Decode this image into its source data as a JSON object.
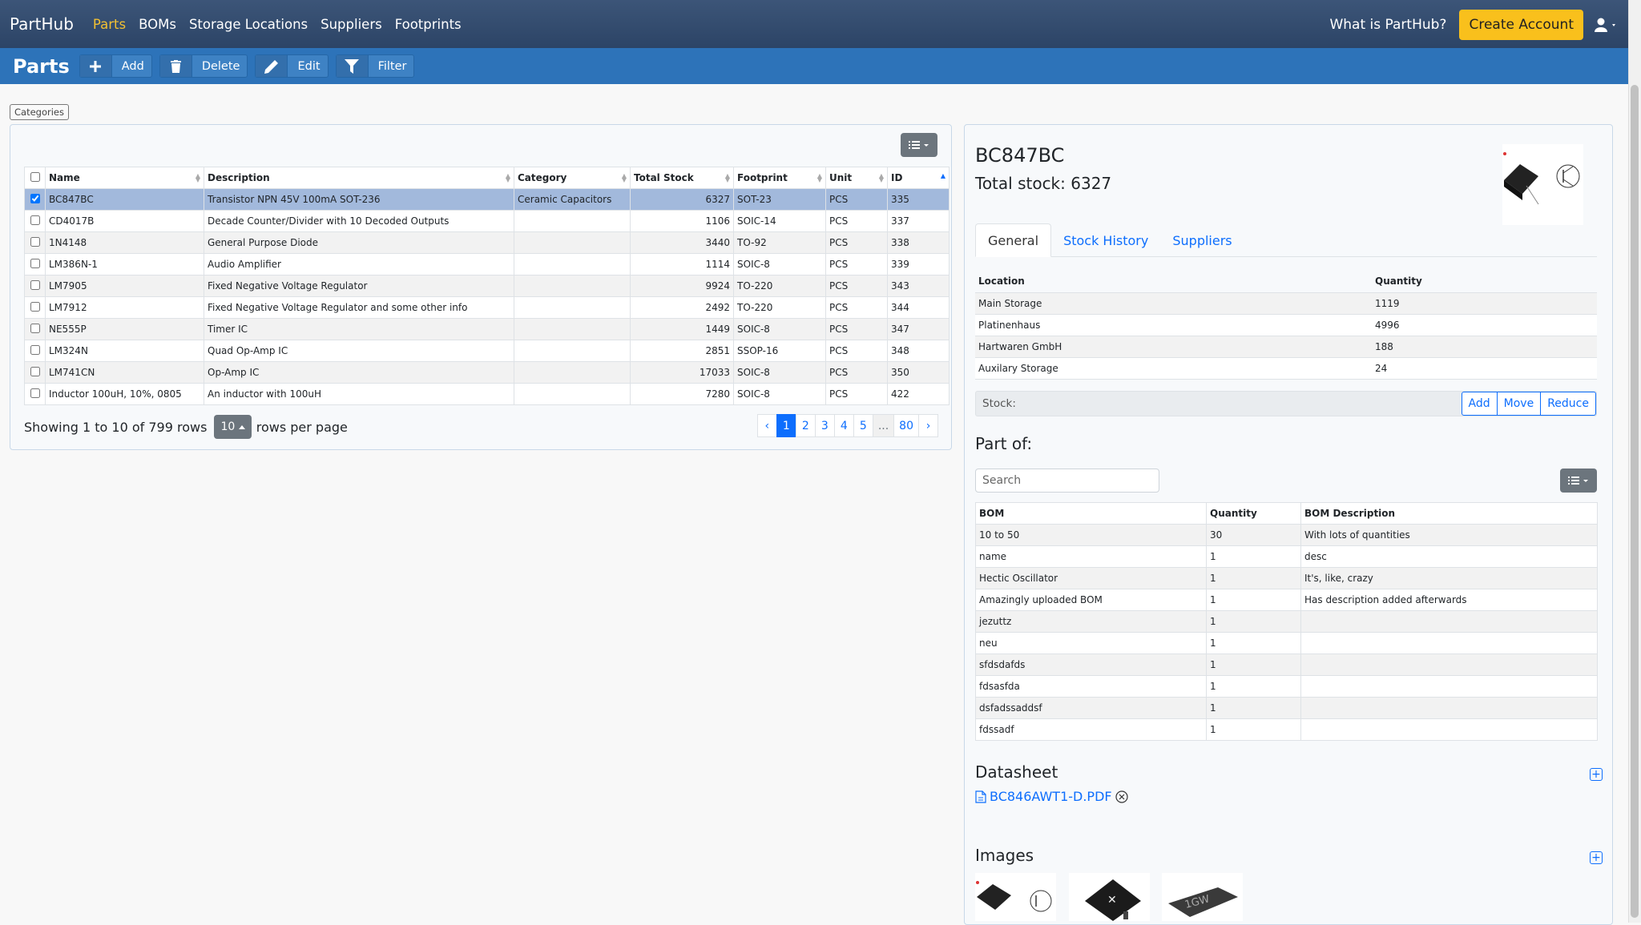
{
  "nav": {
    "brand": "PartHub",
    "links": [
      "Parts",
      "BOMs",
      "Storage Locations",
      "Suppliers",
      "Footprints"
    ],
    "what_is": "What is PartHub?",
    "create_account": "Create Account"
  },
  "toolbar": {
    "title": "Parts",
    "add": "Add",
    "delete": "Delete",
    "edit": "Edit",
    "filter": "Filter"
  },
  "categories_label": "Categories",
  "parts_table": {
    "headers": [
      "Name",
      "Description",
      "Category",
      "Total Stock",
      "Footprint",
      "Unit",
      "ID"
    ],
    "rows": [
      {
        "name": "BC847BC",
        "description": "Transistor NPN 45V 100mA SOT-236",
        "category": "Ceramic Capacitors",
        "stock": "6327",
        "footprint": "SOT-23",
        "unit": "PCS",
        "id": "335",
        "checked": true
      },
      {
        "name": "CD4017B",
        "description": "Decade Counter/Divider with 10 Decoded Outputs",
        "category": "",
        "stock": "1106",
        "footprint": "SOIC-14",
        "unit": "PCS",
        "id": "337",
        "checked": false
      },
      {
        "name": "1N4148",
        "description": "General Purpose Diode",
        "category": "",
        "stock": "3440",
        "footprint": "TO-92",
        "unit": "PCS",
        "id": "338",
        "checked": false
      },
      {
        "name": "LM386N-1",
        "description": "Audio Amplifier",
        "category": "",
        "stock": "1114",
        "footprint": "SOIC-8",
        "unit": "PCS",
        "id": "339",
        "checked": false
      },
      {
        "name": "LM7905",
        "description": "Fixed Negative Voltage Regulator",
        "category": "",
        "stock": "9924",
        "footprint": "TO-220",
        "unit": "PCS",
        "id": "343",
        "checked": false
      },
      {
        "name": "LM7912",
        "description": "Fixed Negative Voltage Regulator and some other info",
        "category": "",
        "stock": "2492",
        "footprint": "TO-220",
        "unit": "PCS",
        "id": "344",
        "checked": false
      },
      {
        "name": "NE555P",
        "description": "Timer IC",
        "category": "",
        "stock": "1449",
        "footprint": "SOIC-8",
        "unit": "PCS",
        "id": "347",
        "checked": false
      },
      {
        "name": "LM324N",
        "description": "Quad Op-Amp IC",
        "category": "",
        "stock": "2851",
        "footprint": "SSOP-16",
        "unit": "PCS",
        "id": "348",
        "checked": false
      },
      {
        "name": "LM741CN",
        "description": "Op-Amp IC",
        "category": "",
        "stock": "17033",
        "footprint": "SOIC-8",
        "unit": "PCS",
        "id": "350",
        "checked": false
      },
      {
        "name": "Inductor 100uH, 10%, 0805",
        "description": "An inductor with 100uH",
        "category": "",
        "stock": "7280",
        "footprint": "SOIC-8",
        "unit": "PCS",
        "id": "422",
        "checked": false
      }
    ],
    "showing": "Showing 1 to 10 of 799 rows",
    "per_page": "10",
    "rows_per_page": "rows per page",
    "pages": [
      "‹",
      "1",
      "2",
      "3",
      "4",
      "5",
      "...",
      "80",
      "›"
    ]
  },
  "detail": {
    "name": "BC847BC",
    "total_stock": "Total stock: 6327",
    "tabs": [
      "General",
      "Stock History",
      "Suppliers"
    ],
    "location_headers": [
      "Location",
      "Quantity"
    ],
    "locations": [
      {
        "location": "Main Storage",
        "quantity": "1119"
      },
      {
        "location": "Platinenhaus",
        "quantity": "4996"
      },
      {
        "location": "Hartwaren GmbH",
        "quantity": "188"
      },
      {
        "location": "Auxilary Storage",
        "quantity": "24"
      }
    ],
    "stock_label": "Stock:",
    "stock_add": "Add",
    "stock_move": "Move",
    "stock_reduce": "Reduce",
    "part_of": "Part of:",
    "search_placeholder": "Search",
    "bom_headers": [
      "BOM",
      "Quantity",
      "BOM Description"
    ],
    "boms": [
      {
        "bom": "10 to 50",
        "quantity": "30",
        "desc": "With lots of quantities"
      },
      {
        "bom": "name",
        "quantity": "1",
        "desc": "desc"
      },
      {
        "bom": "Hectic Oscillator",
        "quantity": "1",
        "desc": "It's, like, crazy"
      },
      {
        "bom": "Amazingly uploaded BOM",
        "quantity": "1",
        "desc": "Has description added afterwards"
      },
      {
        "bom": "jezuttz",
        "quantity": "1",
        "desc": ""
      },
      {
        "bom": "neu",
        "quantity": "1",
        "desc": ""
      },
      {
        "bom": "sfdsdafds",
        "quantity": "1",
        "desc": ""
      },
      {
        "bom": "fdsasfda",
        "quantity": "1",
        "desc": ""
      },
      {
        "bom": "dsfadssaddsf",
        "quantity": "1",
        "desc": ""
      },
      {
        "bom": "fdssadf",
        "quantity": "1",
        "desc": ""
      }
    ],
    "datasheet": "Datasheet",
    "datasheet_file": "BC846AWT1-D.PDF",
    "images": "Images"
  },
  "colors": {
    "nav_bg": "#2f4a6e",
    "toolbar_bg": "#2d73b9",
    "accent_yellow": "#f9c01c",
    "link_blue": "#0d6efd",
    "selected_row": "#a2b9dc"
  }
}
